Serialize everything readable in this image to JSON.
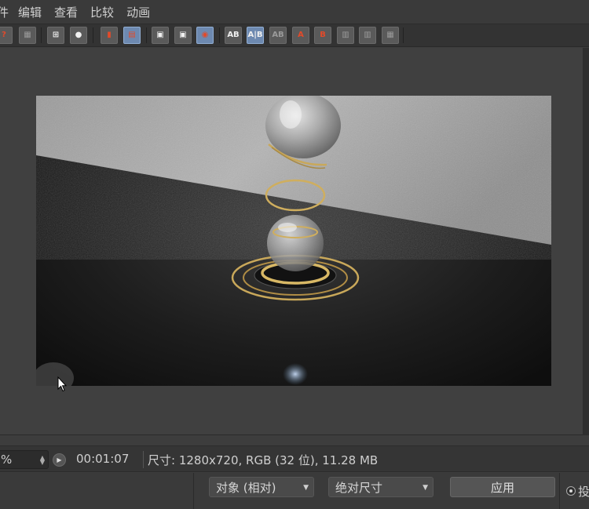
{
  "menu": [
    {
      "label": "件"
    },
    {
      "label": "编辑"
    },
    {
      "label": "查看"
    },
    {
      "label": "比较"
    },
    {
      "label": "动画"
    }
  ],
  "toolbar": {
    "buttons": [
      {
        "glyph": "?",
        "style": "red"
      },
      {
        "glyph": "▦",
        "style": "gray"
      },
      {
        "glyph": "⊞",
        "style": "white"
      },
      {
        "glyph": "●",
        "style": "white"
      },
      {
        "glyph": "▮",
        "style": "red"
      },
      {
        "glyph": "▤",
        "style": "red"
      },
      {
        "glyph": "▣",
        "style": "white"
      },
      {
        "glyph": "▣",
        "style": "white"
      },
      {
        "glyph": "◉",
        "style": "red"
      },
      {
        "glyph": "AB",
        "style": "white"
      },
      {
        "glyph": "A|B",
        "style": "white"
      },
      {
        "glyph": "AB",
        "style": "gray"
      },
      {
        "glyph": "A",
        "style": "red"
      },
      {
        "glyph": "B",
        "style": "red"
      },
      {
        "glyph": "▥",
        "style": "gray"
      },
      {
        "glyph": "▥",
        "style": "gray"
      },
      {
        "glyph": "▦",
        "style": "gray"
      }
    ]
  },
  "status": {
    "zoom": "%",
    "timecode": "00:01:07",
    "info": "尺寸: 1280x720, RGB (32 位), 11.28 MB"
  },
  "bottom": {
    "mode_select": "对象 (相对)",
    "size_select": "绝对尺寸",
    "apply_label": "应用",
    "radio_label": "投"
  }
}
